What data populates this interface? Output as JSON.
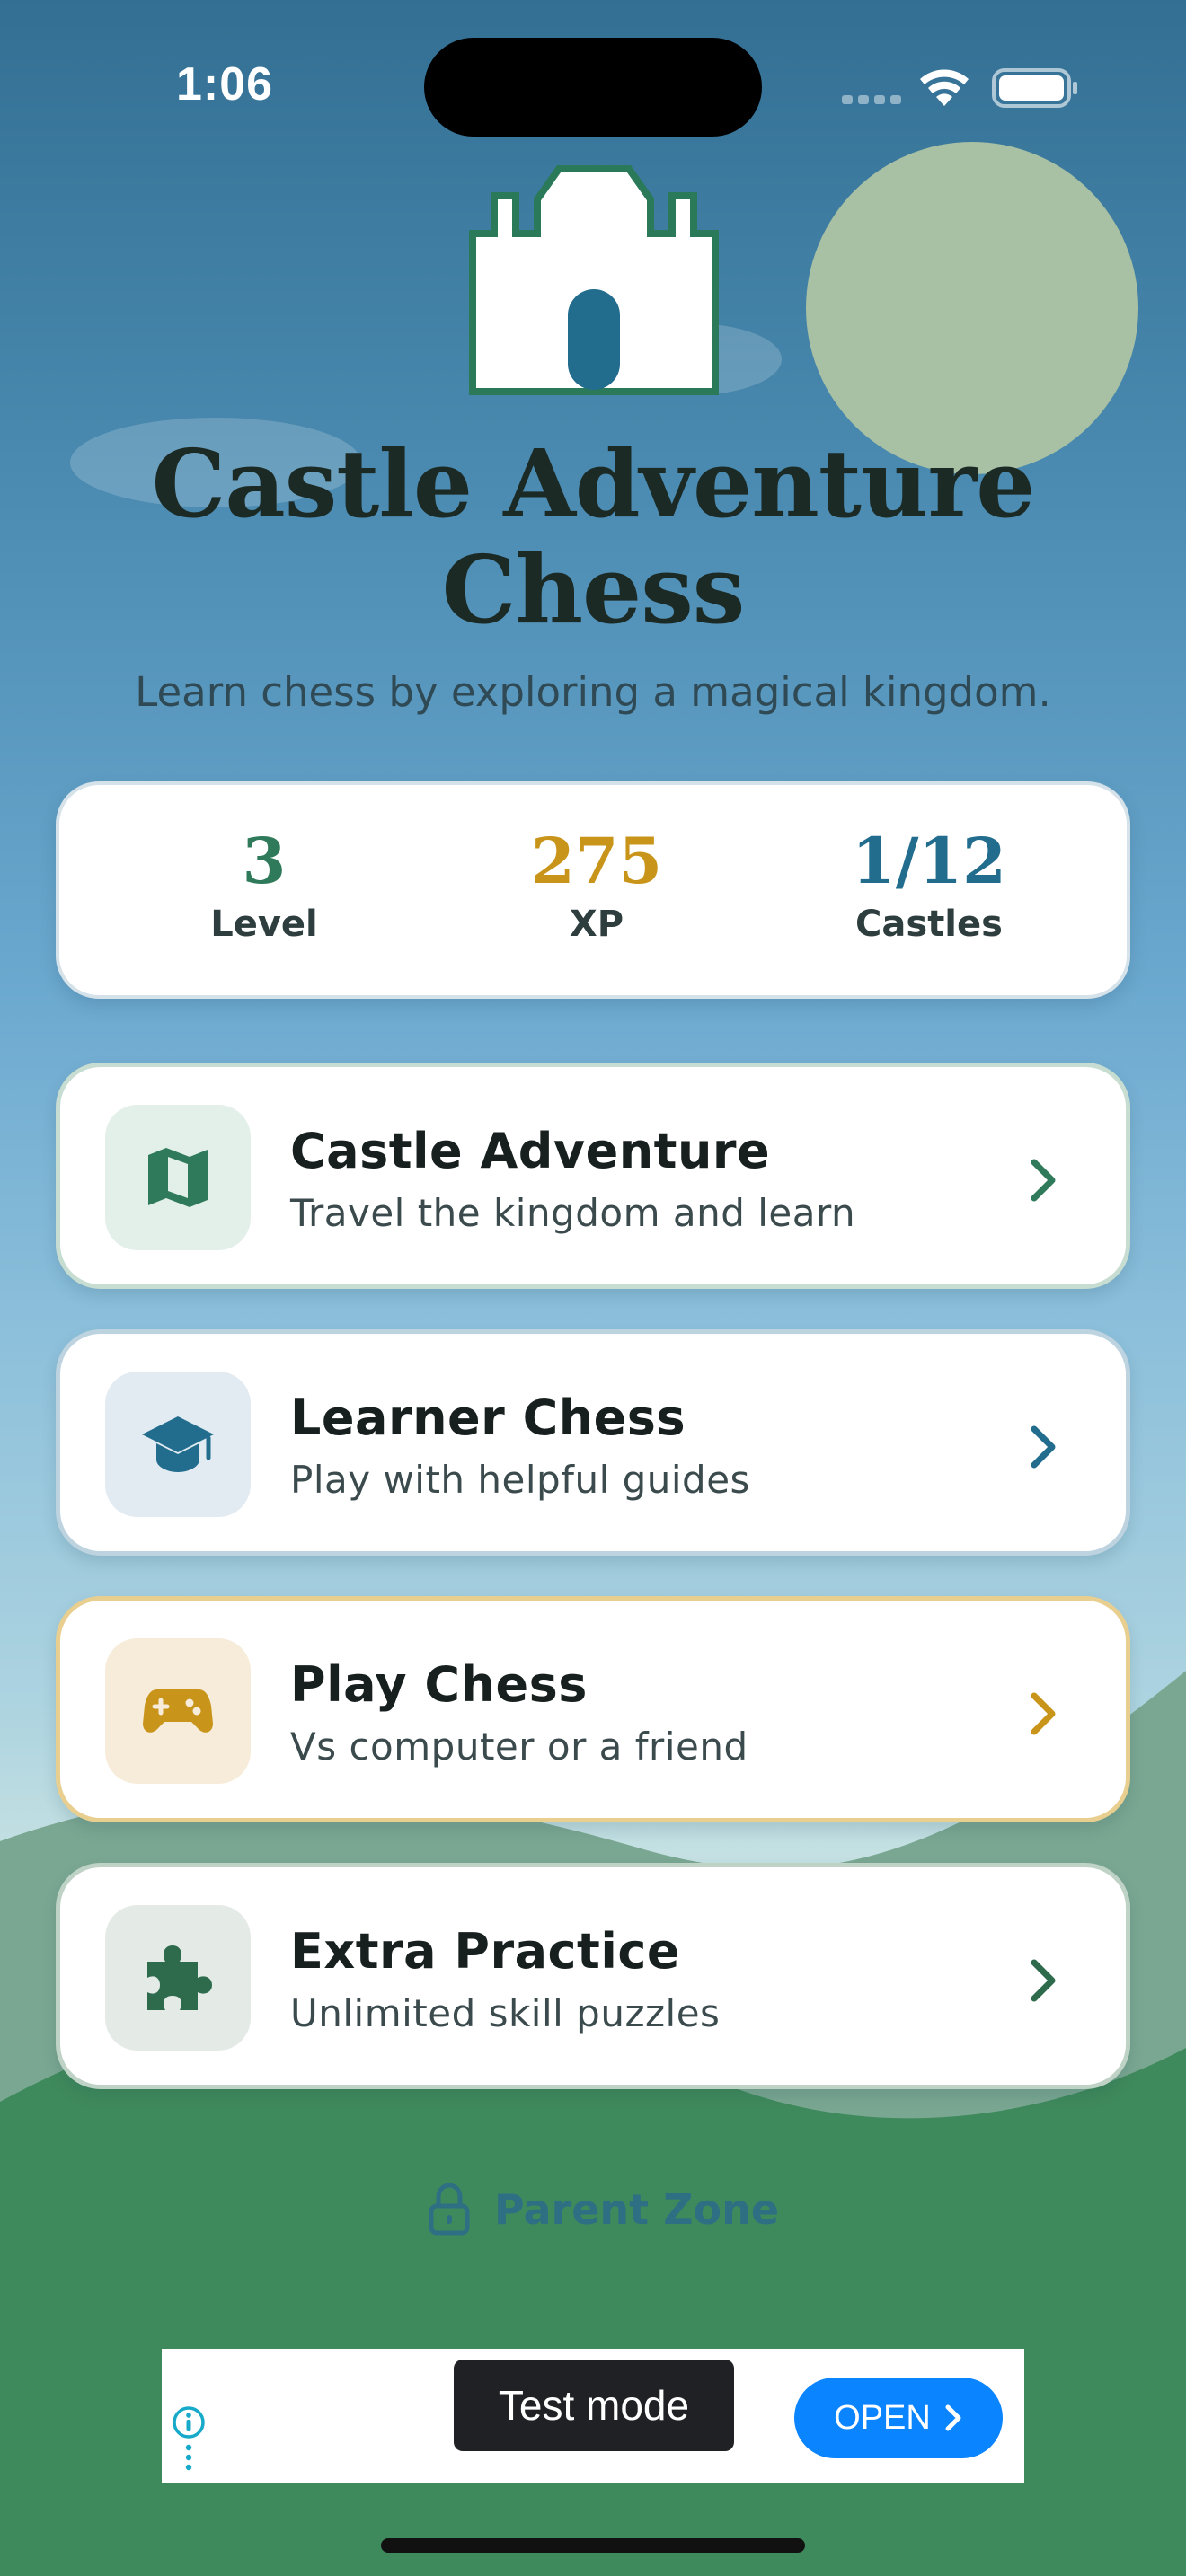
{
  "status_bar": {
    "time": "1:06",
    "icons": [
      "cellular-icon",
      "wifi-icon",
      "battery-icon"
    ]
  },
  "header": {
    "title_line1": "Castle Adventure",
    "title_line2": "Chess",
    "subtitle": "Learn chess by exploring a magical kingdom."
  },
  "stats": [
    {
      "value": "3",
      "label": "Level",
      "color": "#2e7a5a"
    },
    {
      "value": "275",
      "label": "XP",
      "color": "#c9941a"
    },
    {
      "value": "1/12",
      "label": "Castles",
      "color": "#226c8e"
    }
  ],
  "menu": [
    {
      "title": "Castle Adventure",
      "subtitle": "Travel the kingdom and learn",
      "icon": "map-icon",
      "accent": "#2e7a5a",
      "icon_bg": "#e3efe9",
      "border": "#c7ddd2"
    },
    {
      "title": "Learner Chess",
      "subtitle": "Play with helpful guides",
      "icon": "graduation-cap-icon",
      "accent": "#226c8e",
      "icon_bg": "#e1ebf1",
      "border": "#bed3e0"
    },
    {
      "title": "Play Chess",
      "subtitle": "Vs computer or a friend",
      "icon": "gamepad-icon",
      "accent": "#c9941a",
      "icon_bg": "#f6ecd9",
      "border": "#e8cf90"
    },
    {
      "title": "Extra Practice",
      "subtitle": "Unlimited skill puzzles",
      "icon": "puzzle-icon",
      "accent": "#2d6b4c",
      "icon_bg": "#e4ebe6",
      "border": "#bfd2c6"
    }
  ],
  "parent_zone": {
    "label": "Parent Zone",
    "icon": "lock-icon"
  },
  "ad": {
    "test_mode_label": "Test mode",
    "open_label": "OPEN"
  }
}
